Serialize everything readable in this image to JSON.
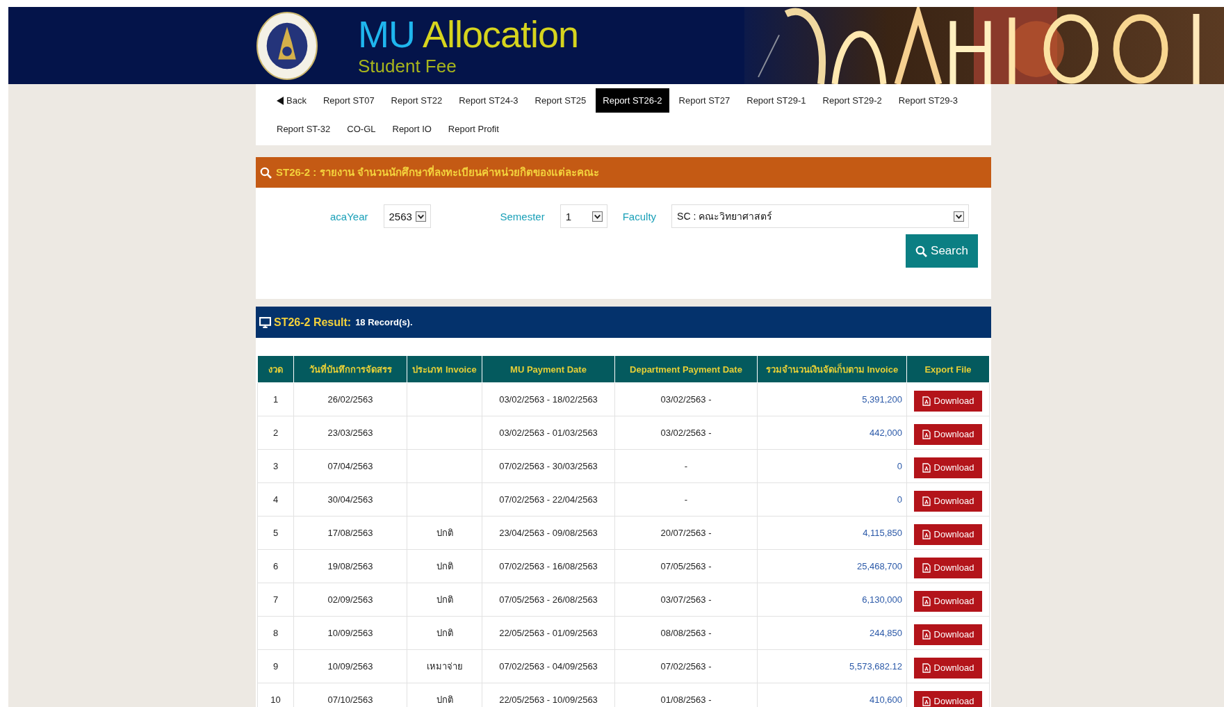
{
  "header": {
    "title_part1": "MU",
    "title_part2": "Allocation",
    "subtitle": "Student Fee"
  },
  "nav": {
    "back": "Back",
    "tabs": [
      {
        "label": "Report ST07",
        "selected": false
      },
      {
        "label": "Report ST22",
        "selected": false
      },
      {
        "label": "Report ST24-3",
        "selected": false
      },
      {
        "label": "Report ST25",
        "selected": false
      },
      {
        "label": "Report ST26-2",
        "selected": true
      },
      {
        "label": "Report ST27",
        "selected": false
      },
      {
        "label": "Report ST29-1",
        "selected": false
      },
      {
        "label": "Report ST29-2",
        "selected": false
      },
      {
        "label": "Report ST29-3",
        "selected": false
      },
      {
        "label": "Report ST-32",
        "selected": false
      },
      {
        "label": "CO-GL",
        "selected": false
      },
      {
        "label": "Report IO",
        "selected": false
      },
      {
        "label": "Report Profit",
        "selected": false
      }
    ]
  },
  "search_panel": {
    "title": "ST26-2 : รายงาน จำนวนนักศึกษาที่ลงทะเบียนค่าหน่วยกิตของแต่ละคณะ",
    "filters": [
      {
        "label": "acaYear",
        "value": "2563"
      },
      {
        "label": "Semester",
        "value": "1"
      },
      {
        "label": "Faculty",
        "value": "SC : คณะวิทยาศาสตร์"
      }
    ],
    "search_button": "Search"
  },
  "result": {
    "title": "ST26-2 Result:",
    "count": "18 Record(s).",
    "columns": [
      "งวด",
      "วันที่บันทึกการจัดสรร",
      "ประเภท Invoice",
      "MU Payment Date",
      "Department Payment Date",
      "รวมจำนวนเงินจัดเก็บตาม Invoice",
      "Export File"
    ],
    "rows": [
      {
        "no": "1",
        "date": "26/02/2563",
        "type": "",
        "mu_date": "03/02/2563 - 18/02/2563",
        "dept_date": "03/02/2563 -",
        "amount": "5,391,200",
        "action": "Download"
      },
      {
        "no": "2",
        "date": "23/03/2563",
        "type": "",
        "mu_date": "03/02/2563 - 01/03/2563",
        "dept_date": "03/02/2563 -",
        "amount": "442,000",
        "action": "Download"
      },
      {
        "no": "3",
        "date": "07/04/2563",
        "type": "",
        "mu_date": "07/02/2563 - 30/03/2563",
        "dept_date": "-",
        "amount": "0",
        "action": "Download"
      },
      {
        "no": "4",
        "date": "30/04/2563",
        "type": "",
        "mu_date": "07/02/2563 - 22/04/2563",
        "dept_date": "-",
        "amount": "0",
        "action": "Download"
      },
      {
        "no": "5",
        "date": "17/08/2563",
        "type": "ปกติ",
        "mu_date": "23/04/2563 - 09/08/2563",
        "dept_date": "20/07/2563 -",
        "amount": "4,115,850",
        "action": "Download"
      },
      {
        "no": "6",
        "date": "19/08/2563",
        "type": "ปกติ",
        "mu_date": "07/02/2563 - 16/08/2563",
        "dept_date": "07/05/2563 -",
        "amount": "25,468,700",
        "action": "Download"
      },
      {
        "no": "7",
        "date": "02/09/2563",
        "type": "ปกติ",
        "mu_date": "07/05/2563 - 26/08/2563",
        "dept_date": "03/07/2563 -",
        "amount": "6,130,000",
        "action": "Download"
      },
      {
        "no": "8",
        "date": "10/09/2563",
        "type": "ปกติ",
        "mu_date": "22/05/2563 - 01/09/2563",
        "dept_date": "08/08/2563 -",
        "amount": "244,850",
        "action": "Download"
      },
      {
        "no": "9",
        "date": "10/09/2563",
        "type": "เหมาจ่าย",
        "mu_date": "07/02/2563 - 04/09/2563",
        "dept_date": "07/02/2563 -",
        "amount": "5,573,682.12",
        "action": "Download"
      },
      {
        "no": "10",
        "date": "07/10/2563",
        "type": "ปกติ",
        "mu_date": "22/05/2563 - 10/09/2563",
        "dept_date": "01/08/2563 -",
        "amount": "410,600",
        "action": "Download"
      }
    ]
  }
}
